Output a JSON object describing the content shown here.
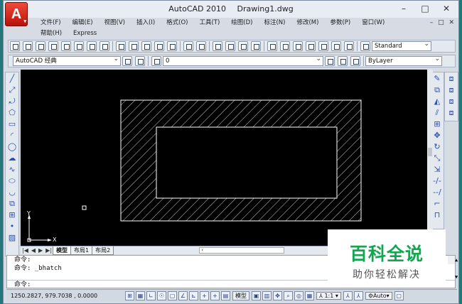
{
  "titlebar": {
    "app_name": "AutoCAD 2010",
    "document": "Drawing1.dwg",
    "app_logo": "A",
    "minimize": "–",
    "maximize": "□",
    "close": "✕"
  },
  "menu": {
    "row1": [
      "文件(F)",
      "编辑(E)",
      "视图(V)",
      "插入(I)",
      "格式(O)",
      "工具(T)",
      "绘图(D)",
      "标注(N)",
      "修改(M)",
      "参数(P)",
      "窗口(W)"
    ],
    "row2": [
      "帮助(H)",
      "Express"
    ],
    "mdi_buttons": "– □ ✕"
  },
  "toolbar_standard": {
    "style_combo": "Standard"
  },
  "toolbar_layers": {
    "workspace_combo": "AutoCAD 经典",
    "layer_combo": "0",
    "color_combo": "ByLayer"
  },
  "tabs": {
    "model": "模型",
    "layout1": "布局1",
    "layout2": "布局2"
  },
  "command": {
    "lines": [
      "命令:",
      "命令:  _bhatch"
    ],
    "prompt": "命令:"
  },
  "statusbar": {
    "coords": "1250.2827,  979.7038 ,  0.0000",
    "model_label": "模型",
    "scale": "1:1",
    "auto_label": "Auto"
  },
  "watermark": {
    "main": "百科全说",
    "sub": "助你轻松解决"
  },
  "ucs": {
    "x_label": "X",
    "y_label": "Y"
  },
  "colors": {
    "drawing_bg": "#000000",
    "hatch_line": "#ffffff",
    "watermark_green": "#12a651"
  }
}
